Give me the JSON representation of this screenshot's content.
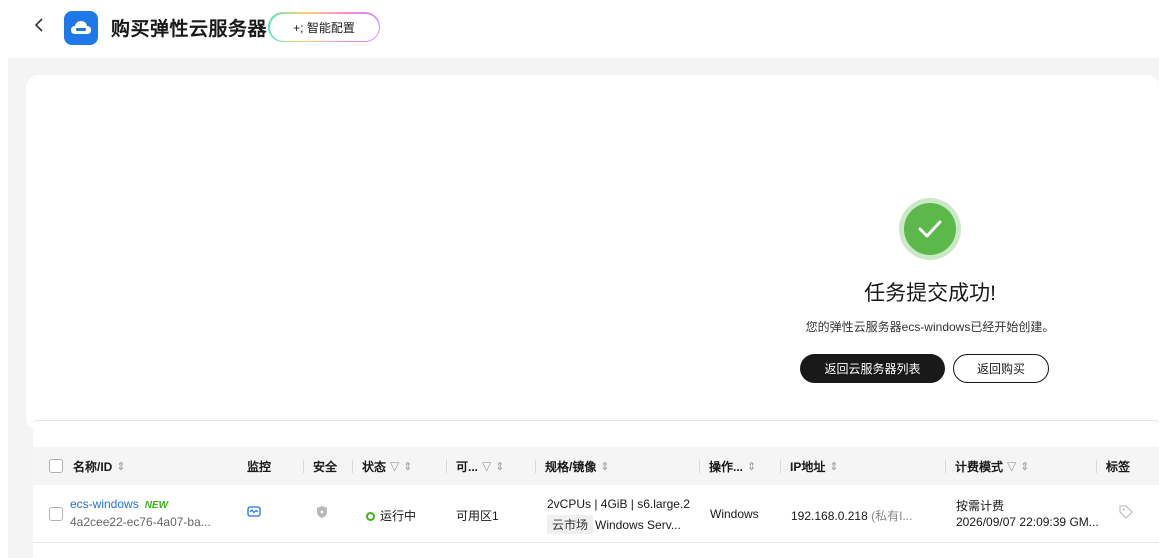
{
  "header": {
    "back_icon": "chevron-left-icon",
    "title": "购买弹性云服务器",
    "smart_config_label": "+; 智能配置"
  },
  "result": {
    "title": "任务提交成功!",
    "description": "您的弹性云服务器ecs-windows已经开始创建。",
    "primary_button": "返回云服务器列表",
    "secondary_button": "返回购买"
  },
  "table": {
    "columns": [
      "名称/ID",
      "监控",
      "安全",
      "状态",
      "可...",
      "规格/镜像",
      "操作...",
      "IP地址",
      "计费模式",
      "标签"
    ],
    "rows": [
      {
        "name": "ecs-windows",
        "badge": "NEW",
        "id": "4a2cee22-ec76-4a07-ba...",
        "status": "运行中",
        "az": "可用区1",
        "spec": "2vCPUs | 4GiB | s6.large.2",
        "image_tag": "云市场",
        "image": "Windows Serv...",
        "os": "Windows",
        "ip": "192.168.0.218",
        "ip_type": "(私有I...",
        "billing": "按需计费",
        "created": "2026/09/07 22:09:39 GM..."
      }
    ]
  },
  "colors": {
    "accent": "#1f6ff2",
    "success": "#5cb84a",
    "dark_button": "#191919"
  }
}
